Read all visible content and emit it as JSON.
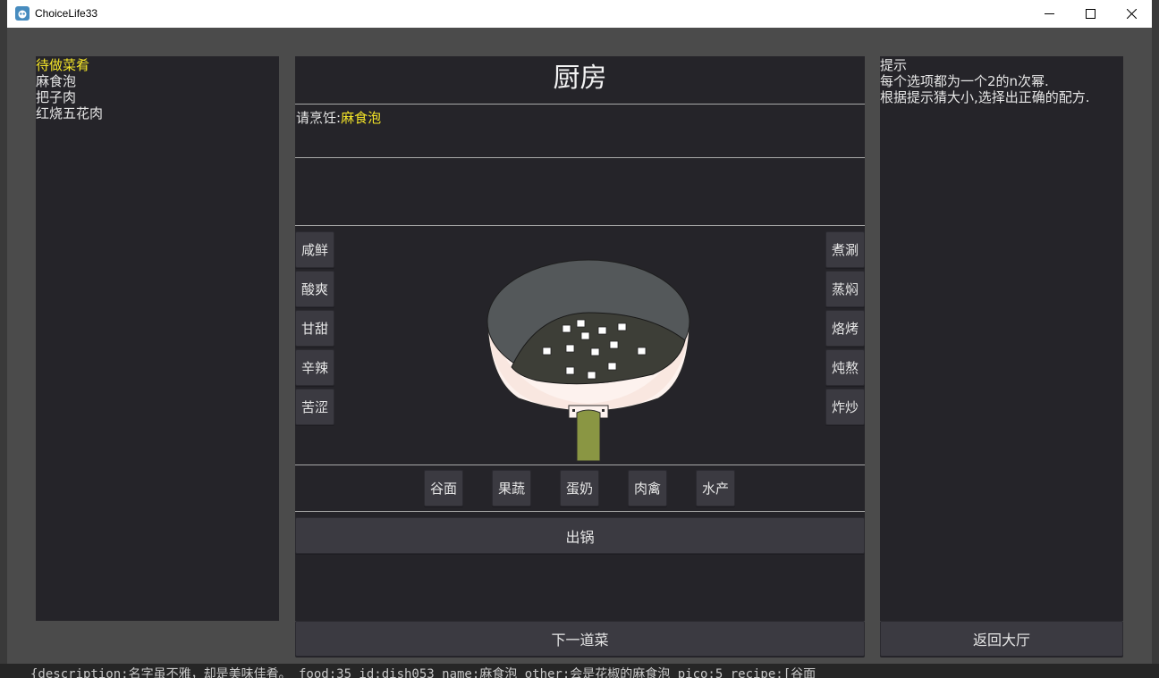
{
  "window": {
    "title": "ChoiceLife33"
  },
  "left_panel": {
    "header": "待做菜肴",
    "dishes": [
      "麻食泡",
      "把子肉",
      "红烧五花肉"
    ]
  },
  "kitchen": {
    "title": "厨房",
    "prompt_prefix": "请烹饪:",
    "dish": "麻食泡",
    "flavor_buttons": [
      "咸鲜",
      "酸爽",
      "甘甜",
      "辛辣",
      "苦涩"
    ],
    "method_buttons": [
      "煮涮",
      "蒸焖",
      "烙烤",
      "炖熬",
      "炸炒"
    ],
    "ingredient_buttons": [
      "谷面",
      "果蔬",
      "蛋奶",
      "肉禽",
      "水产"
    ],
    "serve_button": "出锅",
    "next_button": "下一道菜"
  },
  "right_panel": {
    "header": "提示",
    "lines": [
      "每个选项都为一个2的n次幂.",
      "根据提示猜大小,选择出正确的配方."
    ],
    "back_button": "返回大厅"
  },
  "console": {
    "text": "{description:名字虽不雅，却是美味佳肴。  food:35  id:dish053  name:麻食泡  other:会是花椒的麻食泡  pico:5  recipe:[谷面"
  },
  "colors": {
    "highlight": "#f5e628",
    "panel": "#252429",
    "window_bg": "#4b4b4b"
  }
}
